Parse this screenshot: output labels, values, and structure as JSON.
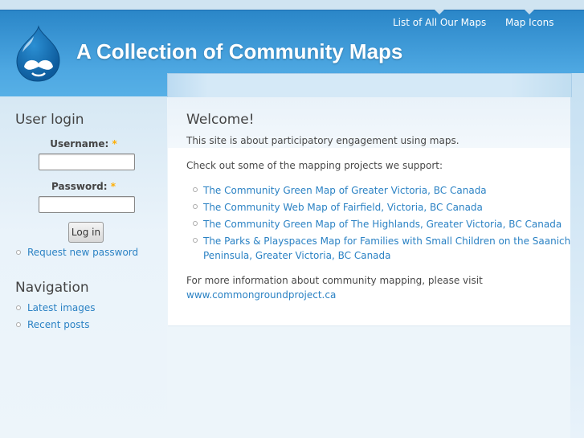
{
  "header": {
    "site_title": "A Collection of Community Maps",
    "logo_icon": "drupal-drop-logo",
    "primary_links": [
      {
        "label": "List of All Our Maps"
      },
      {
        "label": "Map Icons"
      }
    ]
  },
  "sidebar": {
    "user_login": {
      "title": "User login",
      "username_label": "Username:",
      "username_value": "",
      "password_label": "Password:",
      "password_value": "",
      "required_mark": "*",
      "login_button": "Log in",
      "links": [
        {
          "label": "Request new password"
        }
      ]
    },
    "navigation": {
      "title": "Navigation",
      "items": [
        {
          "label": "Latest images"
        },
        {
          "label": "Recent posts"
        }
      ]
    }
  },
  "main": {
    "title": "Welcome!",
    "intro": "This site is about participatory engagement using maps.",
    "projects_heading": "Check out some of the mapping projects we support:",
    "projects": [
      {
        "line1": "The Community Green Map of Greater Victoria, BC Canada"
      },
      {
        "line1": "The Community Web Map of Fairfield, Victoria, BC Canada"
      },
      {
        "line1": "The Community Green Map of The Highlands, Greater Victoria, BC Canada"
      },
      {
        "line1": "The Parks & Playspaces Map for Families with Small Children on the Saanich",
        "line2": "Peninsula, Greater Victoria, BC Canada"
      }
    ],
    "more_info": "For more information about community mapping, please visit",
    "more_info_link": "www.commongroundproject.ca"
  },
  "colors": {
    "header_blue": "#2a86c8",
    "link_blue": "#2b82c4",
    "required_star": "#ffae00"
  }
}
